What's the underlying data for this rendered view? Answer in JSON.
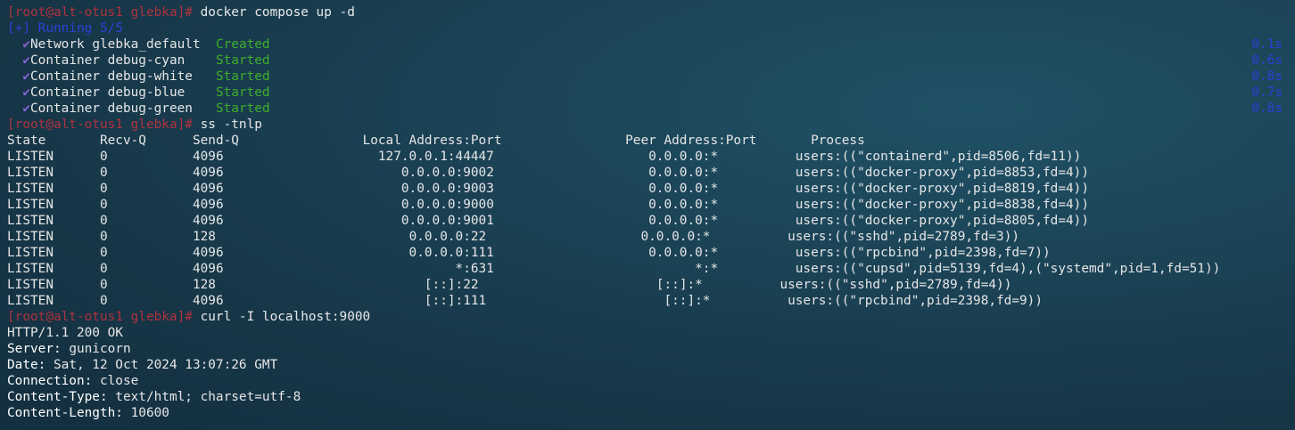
{
  "prompt": "[root@alt-otus1 glebka]#",
  "commands": {
    "compose": " docker compose up -d",
    "ss": " ss -tnlp",
    "curl": " curl -I localhost:9000"
  },
  "compose": {
    "status": "[+] Running 5/5",
    "items": [
      {
        "check": "✔",
        "kind": "Network",
        "name": "glebka_default",
        "state": "Created",
        "time": "0.1s"
      },
      {
        "check": "✔",
        "kind": "Container",
        "name": "debug-cyan",
        "state": "Started",
        "time": "0.6s"
      },
      {
        "check": "✔",
        "kind": "Container",
        "name": "debug-white",
        "state": "Started",
        "time": "0.8s"
      },
      {
        "check": "✔",
        "kind": "Container",
        "name": "debug-blue",
        "state": "Started",
        "time": "0.7s"
      },
      {
        "check": "✔",
        "kind": "Container",
        "name": "debug-green",
        "state": "Started",
        "time": "0.8s"
      }
    ]
  },
  "ss": {
    "header": {
      "state": "State",
      "recvq": "Recv-Q",
      "sendq": "Send-Q",
      "local": "Local Address:Port",
      "peer": "Peer Address:Port",
      "process": "Process"
    },
    "rows": [
      {
        "state": "LISTEN",
        "recvq": "0",
        "sendq": "4096",
        "local": "127.0.0.1:44447",
        "peer": "0.0.0.0:*",
        "process": "users:((\"containerd\",pid=8506,fd=11))"
      },
      {
        "state": "LISTEN",
        "recvq": "0",
        "sendq": "4096",
        "local": "0.0.0.0:9002",
        "peer": "0.0.0.0:*",
        "process": "users:((\"docker-proxy\",pid=8853,fd=4))"
      },
      {
        "state": "LISTEN",
        "recvq": "0",
        "sendq": "4096",
        "local": "0.0.0.0:9003",
        "peer": "0.0.0.0:*",
        "process": "users:((\"docker-proxy\",pid=8819,fd=4))"
      },
      {
        "state": "LISTEN",
        "recvq": "0",
        "sendq": "4096",
        "local": "0.0.0.0:9000",
        "peer": "0.0.0.0:*",
        "process": "users:((\"docker-proxy\",pid=8838,fd=4))"
      },
      {
        "state": "LISTEN",
        "recvq": "0",
        "sendq": "4096",
        "local": "0.0.0.0:9001",
        "peer": "0.0.0.0:*",
        "process": "users:((\"docker-proxy\",pid=8805,fd=4))"
      },
      {
        "state": "LISTEN",
        "recvq": "0",
        "sendq": "128",
        "local": "0.0.0.0:22",
        "peer": "0.0.0.0:*",
        "process": "users:((\"sshd\",pid=2789,fd=3))"
      },
      {
        "state": "LISTEN",
        "recvq": "0",
        "sendq": "4096",
        "local": "0.0.0.0:111",
        "peer": "0.0.0.0:*",
        "process": "users:((\"rpcbind\",pid=2398,fd=7))"
      },
      {
        "state": "LISTEN",
        "recvq": "0",
        "sendq": "4096",
        "local": "*:631",
        "peer": "*:*",
        "process": "users:((\"cupsd\",pid=5139,fd=4),(\"systemd\",pid=1,fd=51))"
      },
      {
        "state": "LISTEN",
        "recvq": "0",
        "sendq": "128",
        "local": "[::]:22",
        "peer": "[::]:*",
        "process": "users:((\"sshd\",pid=2789,fd=4))"
      },
      {
        "state": "LISTEN",
        "recvq": "0",
        "sendq": "4096",
        "local": "[::]:111",
        "peer": "[::]:*",
        "process": "users:((\"rpcbind\",pid=2398,fd=9))"
      }
    ]
  },
  "http": {
    "status": "HTTP/1.1 200 OK",
    "headers": [
      {
        "key": "Server:",
        "value": " gunicorn"
      },
      {
        "key": "Date:",
        "value": " Sat, 12 Oct 2024 13:07:26 GMT"
      },
      {
        "key": "Connection:",
        "value": " close"
      },
      {
        "key": "Content-Type:",
        "value": " text/html; charset=utf-8"
      },
      {
        "key": "Content-Length:",
        "value": " 10600"
      }
    ]
  },
  "colors": {
    "prompt": "#b0323f",
    "running": "#2d3fd6",
    "check": "#8a5fd3",
    "ok": "#3fae2a",
    "background": "#1b4356"
  }
}
